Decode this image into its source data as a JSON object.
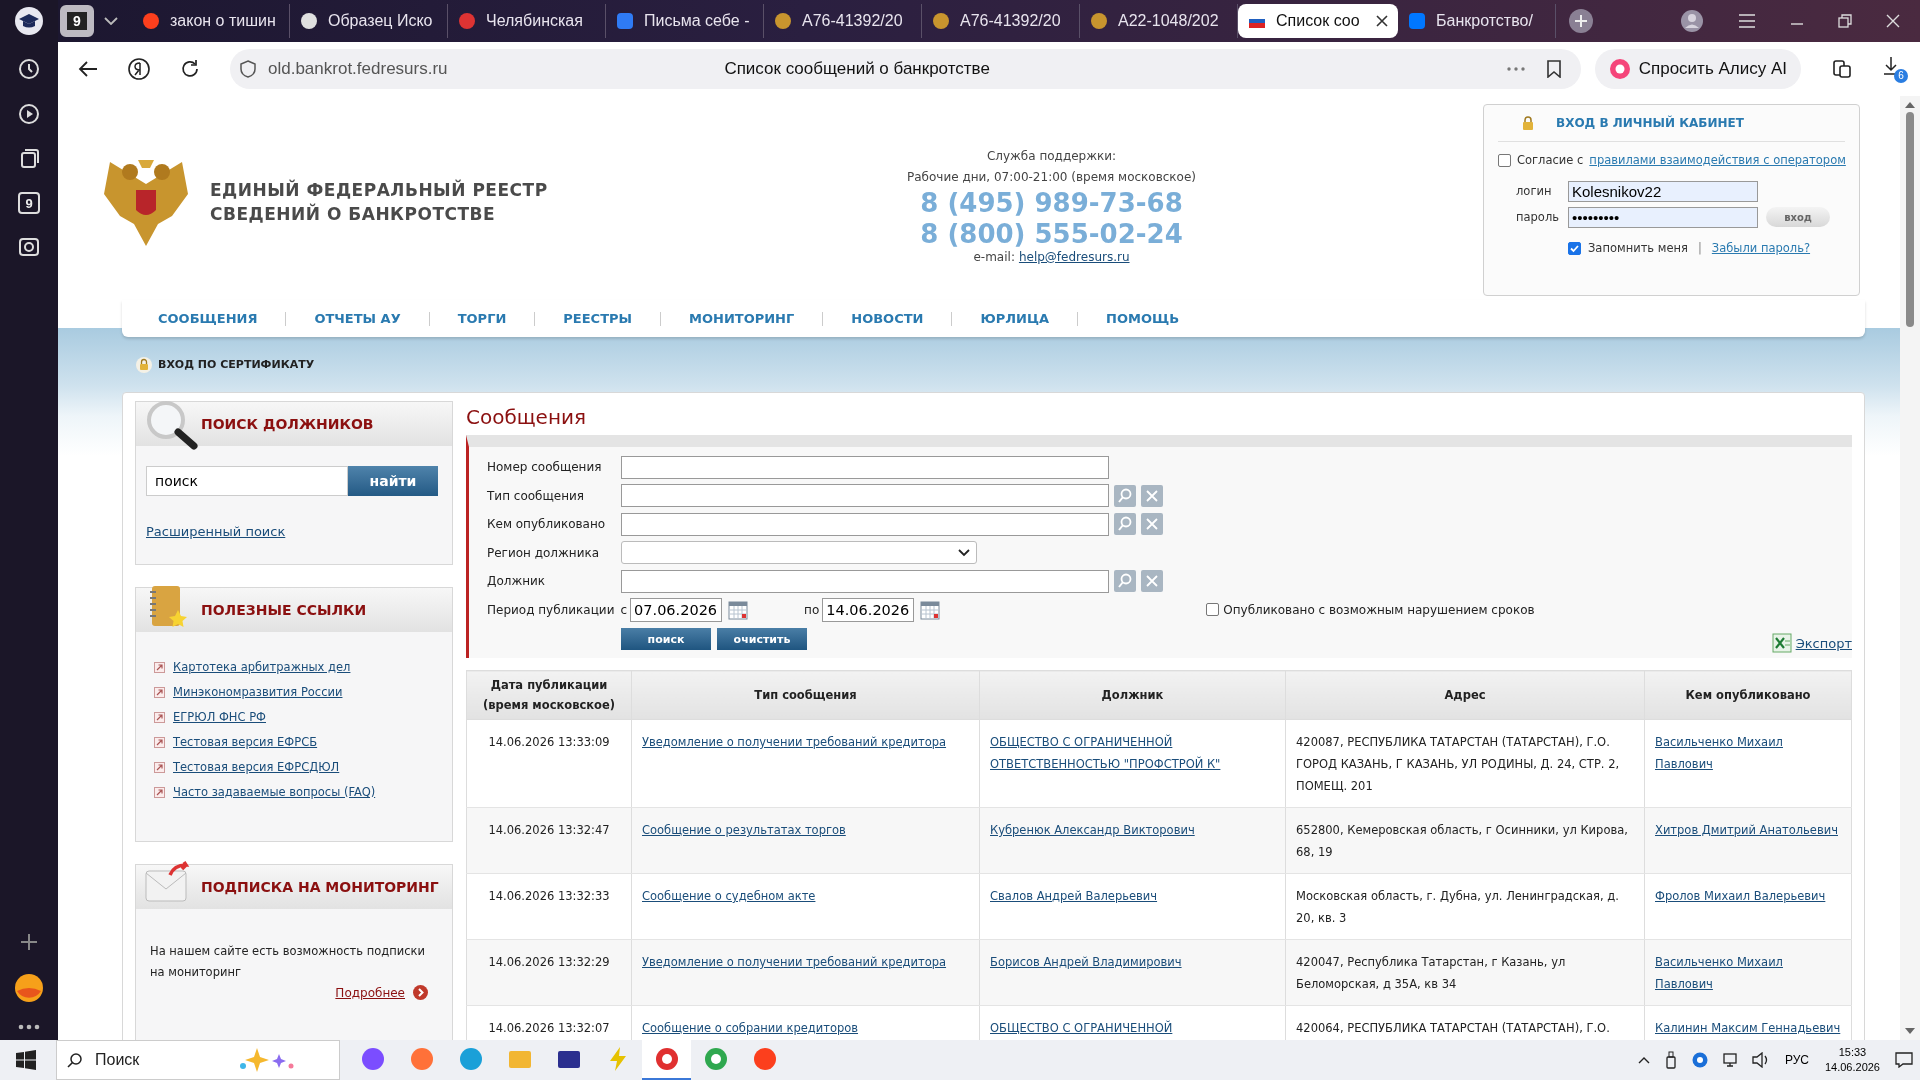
{
  "browser": {
    "sidebar_badge": "9",
    "tab_counter": "9",
    "tabs": [
      {
        "title": "закон о тишин",
        "selected": false
      },
      {
        "title": "Образец Иско",
        "selected": false
      },
      {
        "title": "Челябинская",
        "selected": false
      },
      {
        "title": "Письма себе -",
        "selected": false
      },
      {
        "title": "А76-41392/20",
        "selected": false
      },
      {
        "title": "А76-41392/20",
        "selected": false
      },
      {
        "title": "А22-1048/202",
        "selected": false
      },
      {
        "title": "Список соо",
        "selected": true
      },
      {
        "title": "Банкротство/",
        "selected": false
      }
    ],
    "address": "old.bankrot.fedresurs.ru",
    "page_title": "Список сообщений о банкротстве",
    "alice_button": "Спросить Алису AI",
    "downloads_badge": "6"
  },
  "site": {
    "title_lines": [
      "ЕДИНЫЙ ФЕДЕРАЛЬНЫЙ РЕЕСТР",
      "СВЕДЕНИЙ О БАНКРОТСТВЕ"
    ],
    "support": {
      "label": "Служба поддержки:",
      "hours": "Рабочие дни, 07:00-21:00 (время московское)",
      "phones": [
        "8 (495) 989-73-68",
        "8 (800) 555-02-24"
      ],
      "email_label": "e-mail:",
      "email": "help@fedresurs.ru"
    },
    "login": {
      "title": "ВХОД В ЛИЧНЫЙ КАБИНЕТ",
      "consent": {
        "checked": false,
        "text": "Согласие с",
        "link": "правилами взаимодействия с оператором"
      },
      "login_label": "логин",
      "login_value": "Kolesnikov22",
      "password_label": "пароль",
      "password_value": "•••••••••",
      "submit": "вход",
      "remember": {
        "checked": true,
        "label": "Запомнить меня"
      },
      "separator": "|",
      "forgot": "Забыли пароль?"
    },
    "nav": [
      "СООБЩЕНИЯ",
      "ОТЧЕТЫ АУ",
      "ТОРГИ",
      "РЕЕСТРЫ",
      "МОНИТОРИНГ",
      "НОВОСТИ",
      "ЮРЛИЦА",
      "ПОМОЩЬ"
    ],
    "certificate_login": "ВХОД ПО СЕРТИФИКАТУ"
  },
  "sidebar": {
    "debtor_search": {
      "title": "ПОИСК ДОЛЖНИКОВ",
      "value": "поиск",
      "button": "найти",
      "advanced": "Расширенный поиск"
    },
    "links": {
      "title": "ПОЛЕЗНЫЕ ССЫЛКИ",
      "items": [
        "Картотека арбитражных дел",
        "Минэкономразвития России",
        "ЕГРЮЛ ФНС РФ",
        "Тестовая версия ЕФРСБ",
        "Тестовая версия ЕФРСДЮЛ",
        "Часто задаваемые вопросы (FAQ)"
      ]
    },
    "monitoring": {
      "title": "ПОДПИСКА НА МОНИТОРИНГ",
      "text": "На нашем сайте есть возможность подписки на мониторинг",
      "more": "Подробнее"
    }
  },
  "messages": {
    "title": "Сообщения",
    "fields": [
      {
        "label": "Номер сообщения",
        "kind": "text"
      },
      {
        "label": "Тип сообщения",
        "kind": "lookup"
      },
      {
        "label": "Кем опубликовано",
        "kind": "lookup"
      },
      {
        "label": "Регион должника",
        "kind": "select"
      },
      {
        "label": "Должник",
        "kind": "lookup"
      }
    ],
    "period": {
      "label": "Период публикации",
      "from_label": "с",
      "from": "07.06.2026",
      "to_label": "по",
      "to": "14.06.2026"
    },
    "violation": {
      "checked": false,
      "label": "Опубликовано с возможным нарушением сроков"
    },
    "buttons": [
      "поиск",
      "очистить"
    ],
    "export": "Экспорт",
    "table": {
      "columns": [
        "Дата публикации (время московское)",
        "Тип сообщения",
        "Должник",
        "Адрес",
        "Кем опубликовано"
      ],
      "rows": [
        {
          "date": "14.06.2026 13:33:09",
          "type": "Уведомление о получении требований кредитора",
          "debtor": "ОБЩЕСТВО С ОГРАНИЧЕННОЙ ОТВЕТСТВЕННОСТЬЮ \"ПРОФСТРОЙ К\"",
          "address": "420087, РЕСПУБЛИКА ТАТАРСТАН (ТАТАРСТАН), Г.О. ГОРОД КАЗАНЬ, Г КАЗАНЬ, УЛ РОДИНЫ, Д. 24, СТР. 2, ПОМЕЩ. 201",
          "publisher": "Васильченко Михаил Павлович"
        },
        {
          "date": "14.06.2026 13:32:47",
          "type": "Сообщение о результатах торгов",
          "debtor": "Кубренюк Александр Викторович",
          "address": "652800, Кемеровская область, г Осинники, ул Кирова, 68, 19",
          "publisher": "Хитров Дмитрий Анатольевич"
        },
        {
          "date": "14.06.2026 13:32:33",
          "type": "Сообщение о судебном акте",
          "debtor": "Свалов Андрей Валерьевич",
          "address": "Московская область, г. Дубна, ул. Ленинградская, д. 20, кв. 3",
          "publisher": "Фролов Михаил Валерьевич"
        },
        {
          "date": "14.06.2026 13:32:29",
          "type": "Уведомление о получении требований кредитора",
          "debtor": "Борисов Андрей Владимирович",
          "address": "420047, Республика Татарстан, г Казань, ул Беломорская, д 35А, кв 34",
          "publisher": "Васильченко Михаил Павлович"
        },
        {
          "date": "14.06.2026 13:32:07",
          "type": "Сообщение о собрании кредиторов",
          "debtor": "ОБЩЕСТВО С ОГРАНИЧЕННОЙ",
          "address": "420064, РЕСПУБЛИКА ТАТАРСТАН (ТАТАРСТАН), Г.О.",
          "publisher": "Калинин Максим Геннадьевич"
        }
      ]
    }
  },
  "taskbar": {
    "search_placeholder": "Поиск",
    "apps": [
      {
        "active": false
      },
      {
        "active": false
      },
      {
        "active": false
      },
      {
        "active": false
      },
      {
        "active": false
      },
      {
        "active": false
      },
      {
        "active": true
      },
      {
        "active": false
      },
      {
        "active": false
      }
    ],
    "language": "РУС",
    "time": "15:33",
    "date": "14.06.2026"
  }
}
